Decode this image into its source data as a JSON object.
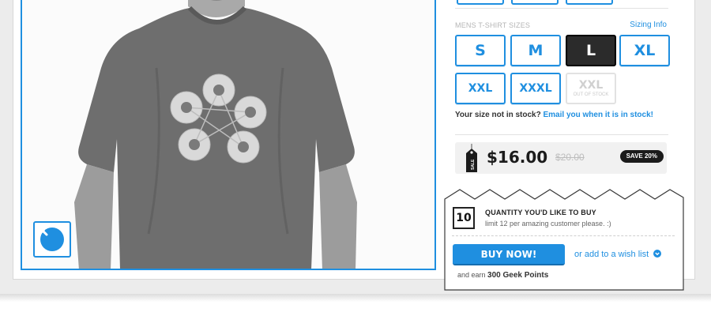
{
  "sizes": {
    "header": "MENS T-SHIRT SIZES",
    "sizing_info_link": "Sizing Info",
    "options": [
      {
        "label": "S",
        "state": "available"
      },
      {
        "label": "M",
        "state": "available"
      },
      {
        "label": "L",
        "state": "selected"
      },
      {
        "label": "XL",
        "state": "available"
      },
      {
        "label": "XXL",
        "state": "available"
      },
      {
        "label": "XXXL",
        "state": "available"
      },
      {
        "label": "XXL",
        "state": "out_of_stock",
        "note": "OUT OF STOCK"
      }
    ],
    "stock_prompt": "Your size not in stock?",
    "stock_link": "Email you when it is in stock!"
  },
  "price": {
    "tag_label": "SALE",
    "current": "$16.00",
    "original": "$20.00",
    "save_badge": "SAVE 20%"
  },
  "purchase": {
    "quantity": "10",
    "quantity_title": "QUANTITY YOU'D LIKE TO BUY",
    "quantity_limit": "limit 12 per amazing customer please. :)",
    "buy_button": "BUY NOW!",
    "wishlist_prefix": "or",
    "wishlist_link": "add to a wish list",
    "points_prefix": "and earn",
    "points_value": "300 Geek Points"
  },
  "colors": {
    "accent": "#1f8fe0",
    "selected": "#2b2b2b",
    "text_dark": "#1b1b1b"
  },
  "icons": [
    "zoom-icon",
    "sale-tag-icon",
    "wishlist-chevron-icon"
  ]
}
